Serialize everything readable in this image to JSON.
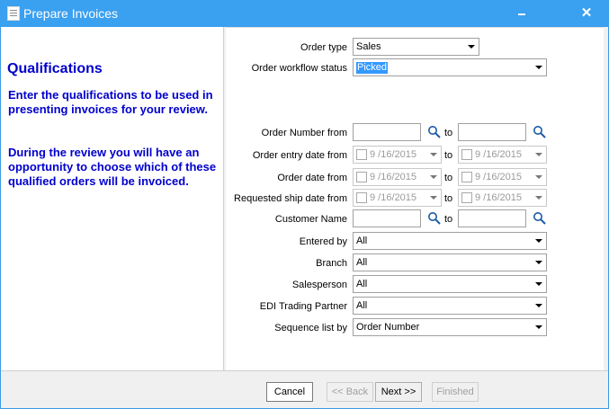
{
  "window": {
    "title": "Prepare Invoices",
    "close_glyph": "✕"
  },
  "left": {
    "title": "Qualifications",
    "text1": "Enter the qualifications to be used in presenting invoices for your review.",
    "text2": "During the review you will have an opportunity to choose which of these qualified orders will be invoiced."
  },
  "form": {
    "order_type": {
      "label": "Order type",
      "value": "Sales"
    },
    "workflow": {
      "label": "Order workflow status",
      "value": "Picked"
    },
    "order_number": {
      "label": "Order Number from",
      "to": "to",
      "from_value": "",
      "to_value": ""
    },
    "entry_date": {
      "label": "Order entry date from",
      "to": "to",
      "from_value": "9 /16/2015",
      "to_value": "9 /16/2015"
    },
    "order_date": {
      "label": "Order date from",
      "to": "to",
      "from_value": "9 /16/2015",
      "to_value": "9 /16/2015"
    },
    "ship_date": {
      "label": "Requested ship date from",
      "to": "to",
      "from_value": "9 /16/2015",
      "to_value": "9 /16/2015"
    },
    "customer": {
      "label": "Customer Name",
      "to": "to",
      "from_value": "",
      "to_value": ""
    },
    "entered_by": {
      "label": "Entered by",
      "value": "All"
    },
    "branch": {
      "label": "Branch",
      "value": "All"
    },
    "salesperson": {
      "label": "Salesperson",
      "value": "All"
    },
    "edi": {
      "label": "EDI Trading Partner",
      "value": "All"
    },
    "sequence": {
      "label": "Sequence list by",
      "value": "Order Number"
    }
  },
  "buttons": {
    "cancel": "Cancel",
    "back": "<< Back",
    "next": "Next >>",
    "finished": "Finished"
  },
  "icons": {
    "search": "search-icon",
    "dropdown": "chevron-down-icon"
  },
  "colors": {
    "titlebar": "#3aa0f0",
    "heading": "#0000cc",
    "selection": "#3399ff"
  }
}
